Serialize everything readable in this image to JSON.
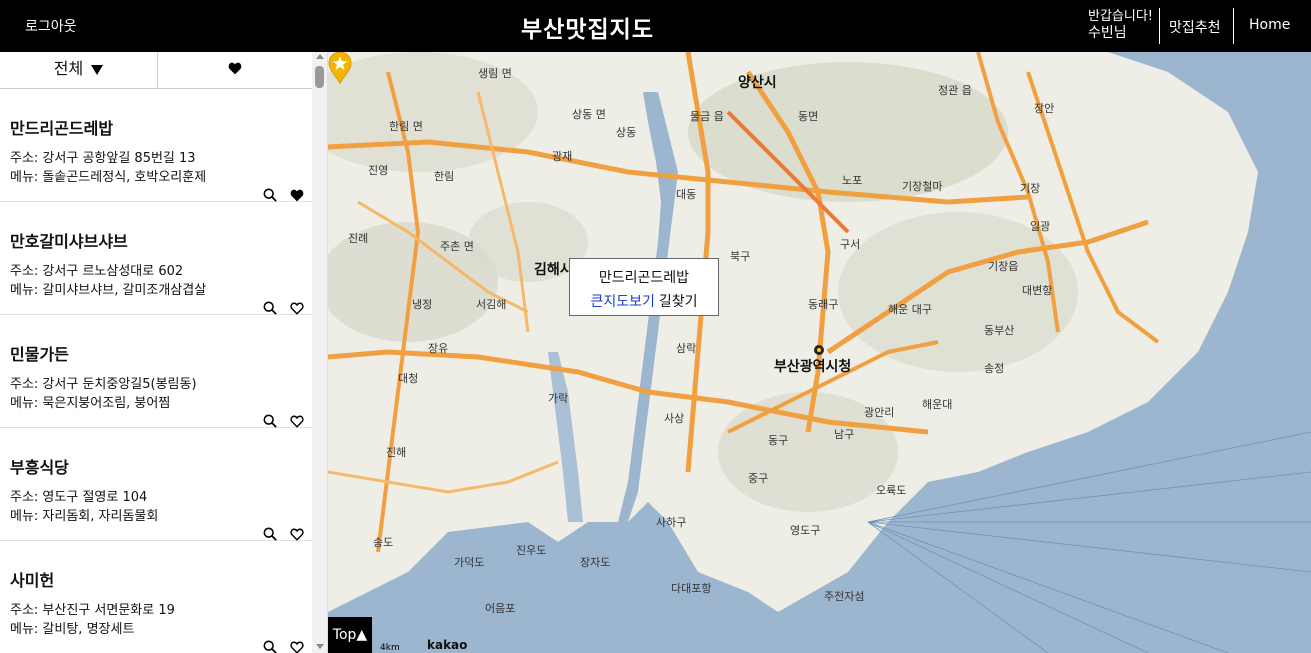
{
  "header": {
    "logout": "로그아웃",
    "title": "부산맛집지도",
    "greeting": "반갑습니다!",
    "user": "수빈님",
    "nav_recommend": "맛집추천",
    "nav_home": "Home"
  },
  "sidebar": {
    "tab_all": "전체",
    "items": [
      {
        "name": "만드리곤드레밥",
        "address": "주소: 강서구 공항앞길 85번길 13",
        "menu": "메뉴: 돌솥곤드레정식, 호박오리훈제",
        "favorite": true
      },
      {
        "name": "만호갈미샤브샤브",
        "address": "주소: 강서구 르노삼성대로 602",
        "menu": "메뉴: 갈미샤브샤브, 갈미조개삼겹살",
        "favorite": false
      },
      {
        "name": "민물가든",
        "address": "주소: 강서구 둔치중앙길5(봉림동)",
        "menu": "메뉴: 묵은지붕어조림, 붕어찜",
        "favorite": false
      },
      {
        "name": "부흥식당",
        "address": "주소: 영도구 절영로 104",
        "menu": "메뉴: 자리돔회, 자리돔물회",
        "favorite": false
      },
      {
        "name": "사미헌",
        "address": "주소: 부산진구 서면문화로 19",
        "menu": "메뉴: 갈비탕, 명장세트",
        "favorite": false
      }
    ]
  },
  "map": {
    "popup": {
      "name": "만드리곤드레밥",
      "big_map": "큰지도보기",
      "route": "길찾기"
    },
    "top_button": "Top",
    "scale": "4km",
    "provider": "kakao",
    "labels": [
      {
        "text": "양산시",
        "cls": "big"
      },
      {
        "text": "김해시",
        "cls": "big"
      },
      {
        "text": "부산광역시청",
        "cls": "big"
      },
      {
        "text": "생림 면",
        "cls": ""
      },
      {
        "text": "상동 면",
        "cls": ""
      },
      {
        "text": "상동",
        "cls": ""
      },
      {
        "text": "물금 읍",
        "cls": ""
      },
      {
        "text": "동면",
        "cls": ""
      },
      {
        "text": "한림 면",
        "cls": ""
      },
      {
        "text": "광재",
        "cls": ""
      },
      {
        "text": "진영",
        "cls": ""
      },
      {
        "text": "한림",
        "cls": ""
      },
      {
        "text": "대동",
        "cls": ""
      },
      {
        "text": "노포",
        "cls": ""
      },
      {
        "text": "기장철마",
        "cls": ""
      },
      {
        "text": "기장",
        "cls": ""
      },
      {
        "text": "정관 읍",
        "cls": ""
      },
      {
        "text": "장안",
        "cls": ""
      },
      {
        "text": "일광",
        "cls": ""
      },
      {
        "text": "진례",
        "cls": ""
      },
      {
        "text": "주촌 면",
        "cls": ""
      },
      {
        "text": "북구",
        "cls": ""
      },
      {
        "text": "구서",
        "cls": ""
      },
      {
        "text": "기장읍",
        "cls": ""
      },
      {
        "text": "대변항",
        "cls": ""
      },
      {
        "text": "냉정",
        "cls": ""
      },
      {
        "text": "서김해",
        "cls": ""
      },
      {
        "text": "동래구",
        "cls": ""
      },
      {
        "text": "해운 대구",
        "cls": ""
      },
      {
        "text": "동부산",
        "cls": ""
      },
      {
        "text": "장유",
        "cls": ""
      },
      {
        "text": "삼락",
        "cls": ""
      },
      {
        "text": "송정",
        "cls": ""
      },
      {
        "text": "대청",
        "cls": ""
      },
      {
        "text": "가락",
        "cls": ""
      },
      {
        "text": "사상",
        "cls": ""
      },
      {
        "text": "광안리",
        "cls": ""
      },
      {
        "text": "해운대",
        "cls": ""
      },
      {
        "text": "동구",
        "cls": ""
      },
      {
        "text": "남구",
        "cls": ""
      },
      {
        "text": "진해",
        "cls": ""
      },
      {
        "text": "중구",
        "cls": ""
      },
      {
        "text": "오륙도",
        "cls": ""
      },
      {
        "text": "사하구",
        "cls": ""
      },
      {
        "text": "영도구",
        "cls": ""
      },
      {
        "text": "송도",
        "cls": ""
      },
      {
        "text": "진우도",
        "cls": ""
      },
      {
        "text": "가덕도",
        "cls": ""
      },
      {
        "text": "장자도",
        "cls": ""
      },
      {
        "text": "다대포항",
        "cls": ""
      },
      {
        "text": "어음포",
        "cls": ""
      },
      {
        "text": "주전자섬",
        "cls": ""
      }
    ]
  },
  "colors": {
    "header_bg": "#000000",
    "link": "#1a3fd0",
    "marker": "#f5b400",
    "water": "#9cb6cf",
    "road": "#f0a040"
  }
}
